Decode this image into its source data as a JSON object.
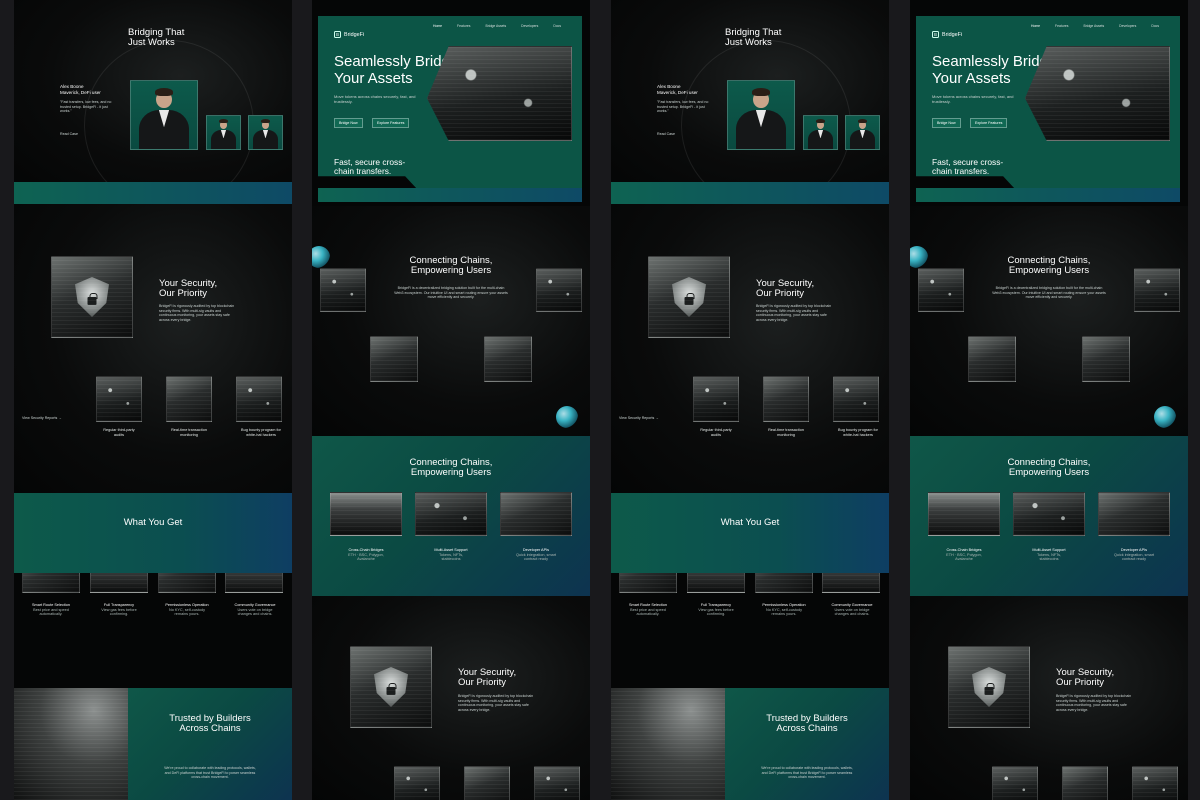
{
  "brand": {
    "name": "BridgeFi",
    "logo_glyph": "B"
  },
  "nav": [
    "Home",
    "Features",
    "Bridge Assets",
    "Developers",
    "Docs"
  ],
  "hero": {
    "title_l1": "Seamlessly Bridge",
    "title_l2": "Your Assets",
    "desc": "Move tokens across chains securely, fast, and trustlessly.",
    "btn_primary": "Bridge Now",
    "btn_secondary": "Explore Features",
    "tagline_l1": "Fast, secure cross-",
    "tagline_l2": "chain transfers."
  },
  "testimonial": {
    "title_l1": "Bridging That",
    "title_l2": "Just Works",
    "name": "Alex Boone",
    "role": "Maverick, DeFi user",
    "quote": "\"Fast transfers, low fees, and no trusted setup. BridgeFi - it just works.\"",
    "link": "Read Case"
  },
  "security": {
    "title_l1": "Your Security,",
    "title_l2": "Our Priority",
    "desc": "BridgeFi is rigorously audited by top blockchain security firms. With multi-sig vaults and continuous monitoring, your assets stay safe across every bridge.",
    "link": "View Security Reports →",
    "items": [
      {
        "l1": "Regular third-party",
        "l2": "audits"
      },
      {
        "l1": "Real-time transaction",
        "l2": "monitoring"
      },
      {
        "l1": "Bug bounty program for",
        "l2": "white-hat hackers"
      }
    ]
  },
  "connect": {
    "title_l1": "Connecting Chains,",
    "title_l2": "Empowering Users",
    "desc": "BridgeFi is a decentralized bridging solution built for the multi-chain Web3 ecosystem. Our intuitive UI and smart routing ensure your assets move efficiently and securely.",
    "features": [
      {
        "title": "Cross-Chain Bridges",
        "l1": "ETH · BSC, Polygon,",
        "l2": "Avalanche"
      },
      {
        "title": "Multi-Asset Support",
        "l1": "Tokens, NFTs,",
        "l2": "stablecoins"
      },
      {
        "title": "Developer APIs",
        "l1": "Quick integration, smart",
        "l2": "contract ready"
      }
    ]
  },
  "what": {
    "title": "What You Get",
    "items": [
      {
        "title": "Smart Route Selection",
        "l1": "Best price and speed",
        "l2": "automatically."
      },
      {
        "title": "Full Transparency",
        "l1": "View gas fees before",
        "l2": "confirming."
      },
      {
        "title": "Permissionless Operation",
        "l1": "No KYC, self-custody",
        "l2": "remains yours."
      },
      {
        "title": "Community Governance",
        "l1": "Users vote on bridge",
        "l2": "changes and chains."
      }
    ]
  },
  "trusted": {
    "title_l1": "Trusted by Builders",
    "title_l2": "Across Chains",
    "desc": "We're proud to collaborate with leading protocols, wallets, and DeFi platforms that trust BridgeFi to power seamless cross-chain movement."
  },
  "colors": {
    "teal": "#0c5546",
    "blue": "#0d3350",
    "bg": "#060707",
    "board": "#19191c"
  }
}
